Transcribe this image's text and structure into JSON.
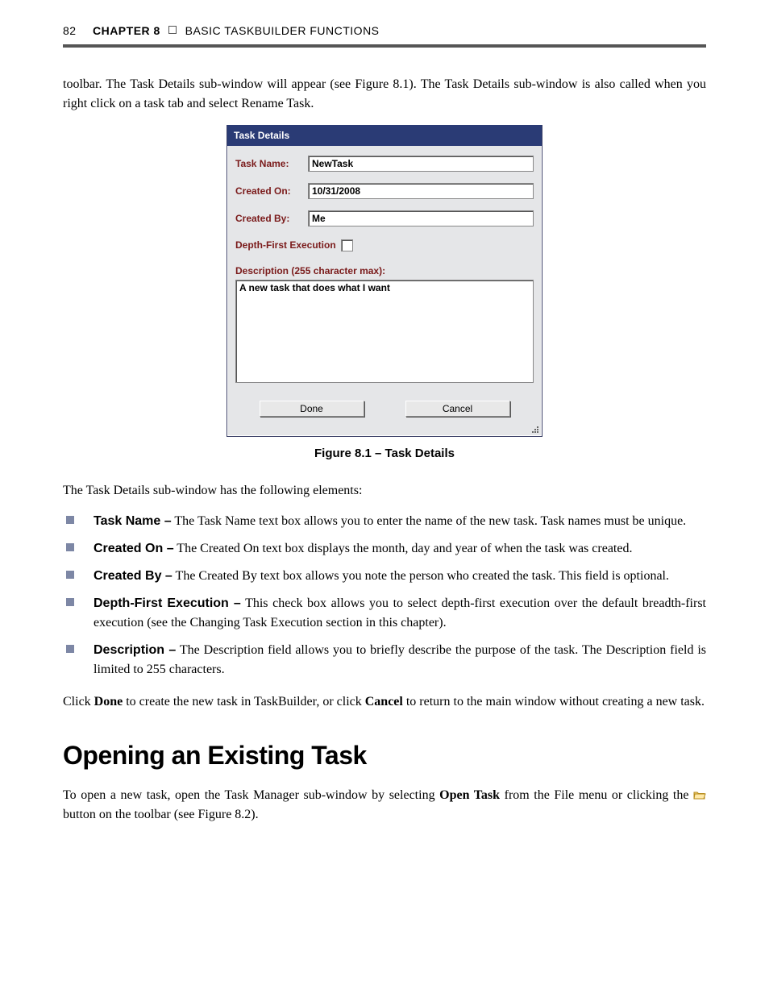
{
  "header": {
    "page_number": "82",
    "chapter_bold": "CHAPTER 8",
    "chapter_rest": "BASIC TASKBUILDER FUNCTIONS"
  },
  "intro": "toolbar. The Task Details sub-window will appear (see Figure 8.1). The Task Details sub-window is also called when you right click on a task tab and select Rename Task.",
  "dialog": {
    "title": "Task Details",
    "rows": {
      "task_name": {
        "label": "Task Name:",
        "value": "NewTask"
      },
      "created_on": {
        "label": "Created On:",
        "value": "10/31/2008"
      },
      "created_by": {
        "label": "Created By:",
        "value": "Me"
      }
    },
    "depth_first_label": "Depth-First Execution",
    "description_label": "Description (255 character max):",
    "description_value": "A new task that does what I want",
    "done_label": "Done",
    "cancel_label": "Cancel"
  },
  "caption": "Figure 8.1 – Task Details",
  "elements_intro": "The Task Details sub-window has the following elements:",
  "bullets": {
    "b1_label": "Task Name –",
    "b1_text": " The Task Name text box allows you to enter the name of the new task. Task names must be unique.",
    "b2_label": "Created On –",
    "b2_text": " The Created On text box displays the month, day and year of when the task was created.",
    "b3_label": "Created By –",
    "b3_text": " The Created By text box allows you note the person who created the task. This field is optional.",
    "b4_label": "Depth-First Execution –",
    "b4_text": " This check box allows you to select depth-first execution over the default breadth-first execution (see the Changing Task Execution section in this chapter).",
    "b5_label": "Description –",
    "b5_text": " The Description field allows you to briefly describe the purpose of the task. The Description field is limited to 255 characters."
  },
  "click_para": {
    "pre": "Click ",
    "done": "Done",
    "mid": " to create the new task in TaskBuilder, or click ",
    "cancel": "Cancel",
    "post": " to return to the main window without creating a new task."
  },
  "section_heading": "Opening an Existing Task",
  "open_para": {
    "pre": "To open a new task, open the Task Manager sub-window by selecting ",
    "open_task": "Open Task",
    "mid": " from the File menu or clicking the ",
    "post": " button on the toolbar (see Figure 8.2)."
  }
}
